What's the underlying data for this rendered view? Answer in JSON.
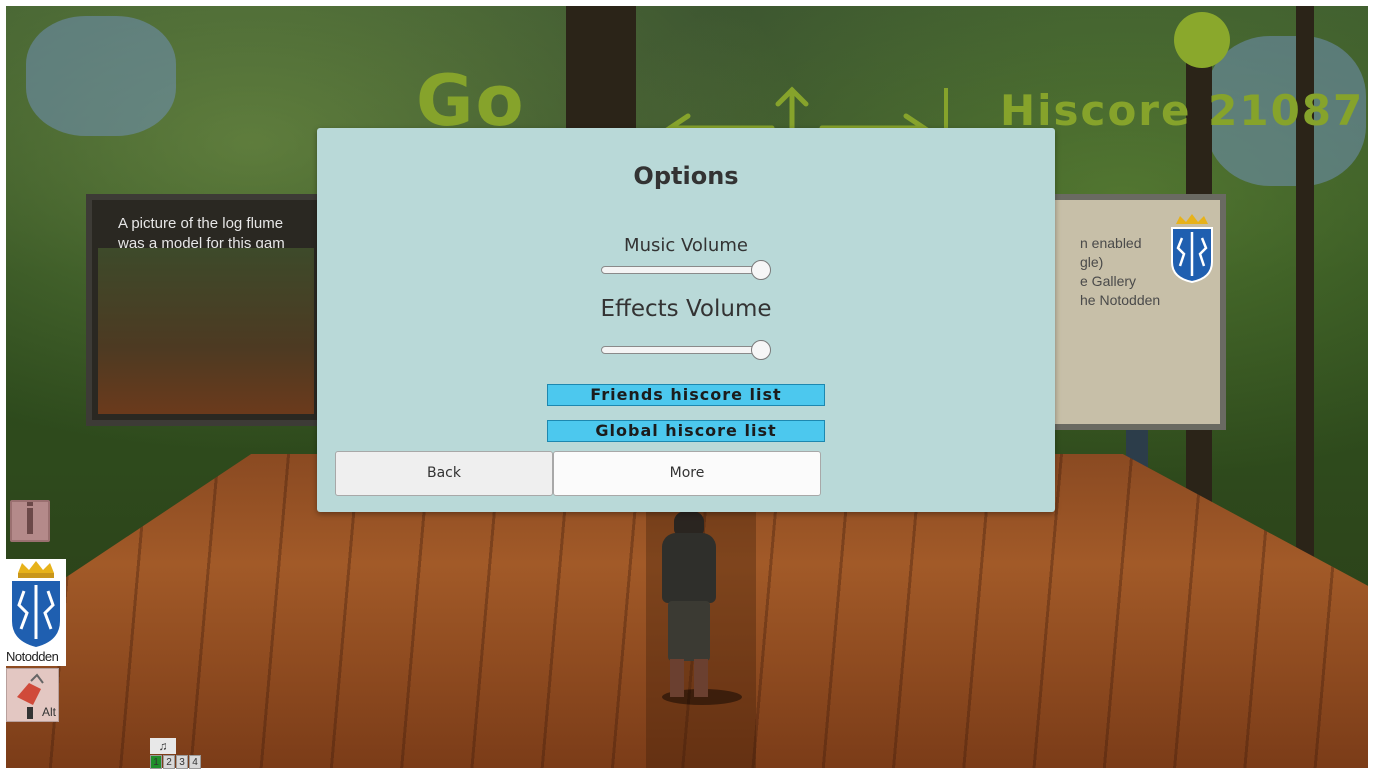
{
  "hud": {
    "go_label": "Go",
    "hiscore_label": "Hiscore 21087"
  },
  "left_board": {
    "line1": "A picture of the log flume",
    "line2": "was a model for this gam"
  },
  "right_board": {
    "line1": "n enabled",
    "line2": "gle)",
    "line3": "e Gallery",
    "line4": "he Notodden"
  },
  "dialog": {
    "title": "Options",
    "music_label": "Music Volume",
    "music_level": 1.0,
    "effects_label": "Effects Volume",
    "effects_level": 1.0,
    "friends_button": "Friends hiscore list",
    "global_button": "Global hiscore list",
    "back_button": "Back",
    "more_button": "More"
  },
  "sidebar": {
    "info_icon": "info-icon",
    "crest_label": "Notodden",
    "alt_label": "Alt"
  },
  "tracks": {
    "note_icon": "♫",
    "items": [
      "1",
      "2",
      "3",
      "4"
    ],
    "active_index": 0
  },
  "colors": {
    "dialog_bg": "#b9d9d8",
    "hiscore_button": "#4cc8ee",
    "hud_green": "#86a32b"
  }
}
